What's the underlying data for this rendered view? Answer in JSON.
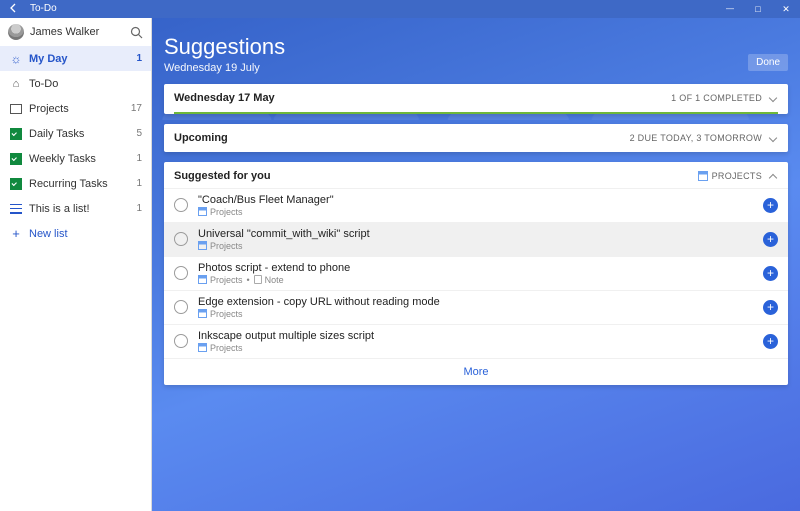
{
  "window": {
    "title": "To-Do"
  },
  "user": {
    "name": "James Walker"
  },
  "sidebar": {
    "items": [
      {
        "id": "myday",
        "label": "My Day",
        "count": "1",
        "icon": "sun",
        "selected": true
      },
      {
        "id": "todo",
        "label": "To-Do",
        "count": "",
        "icon": "home",
        "selected": false
      },
      {
        "id": "projects",
        "label": "Projects",
        "count": "17",
        "icon": "rect",
        "selected": false
      },
      {
        "id": "daily",
        "label": "Daily Tasks",
        "count": "5",
        "icon": "check",
        "selected": false
      },
      {
        "id": "weekly",
        "label": "Weekly Tasks",
        "count": "1",
        "icon": "check",
        "selected": false
      },
      {
        "id": "recur",
        "label": "Recurring Tasks",
        "count": "1",
        "icon": "check",
        "selected": false
      },
      {
        "id": "list1",
        "label": "This is a list!",
        "count": "1",
        "icon": "lines",
        "selected": false
      }
    ],
    "new_list_label": "New list"
  },
  "header": {
    "title": "Suggestions",
    "subtitle": "Wednesday 19 July",
    "done_label": "Done"
  },
  "sections": {
    "completed": {
      "title": "Wednesday 17 May",
      "meta": "1 OF 1 COMPLETED"
    },
    "upcoming": {
      "title": "Upcoming",
      "meta": "2 DUE TODAY, 3 TOMORROW"
    },
    "suggested": {
      "title": "Suggested for you",
      "tag": "PROJECTS"
    }
  },
  "tasks": [
    {
      "title": "\"Coach/Bus Fleet Manager\"",
      "project": "Projects",
      "note": false
    },
    {
      "title": "Universal \"commit_with_wiki\" script",
      "project": "Projects",
      "note": false,
      "hovered": true
    },
    {
      "title": "Photos script - extend to phone",
      "project": "Projects",
      "note": true,
      "note_label": "Note"
    },
    {
      "title": "Edge extension - copy URL without reading mode",
      "project": "Projects",
      "note": false
    },
    {
      "title": "Inkscape output multiple sizes script",
      "project": "Projects",
      "note": false
    }
  ],
  "more_label": "More"
}
